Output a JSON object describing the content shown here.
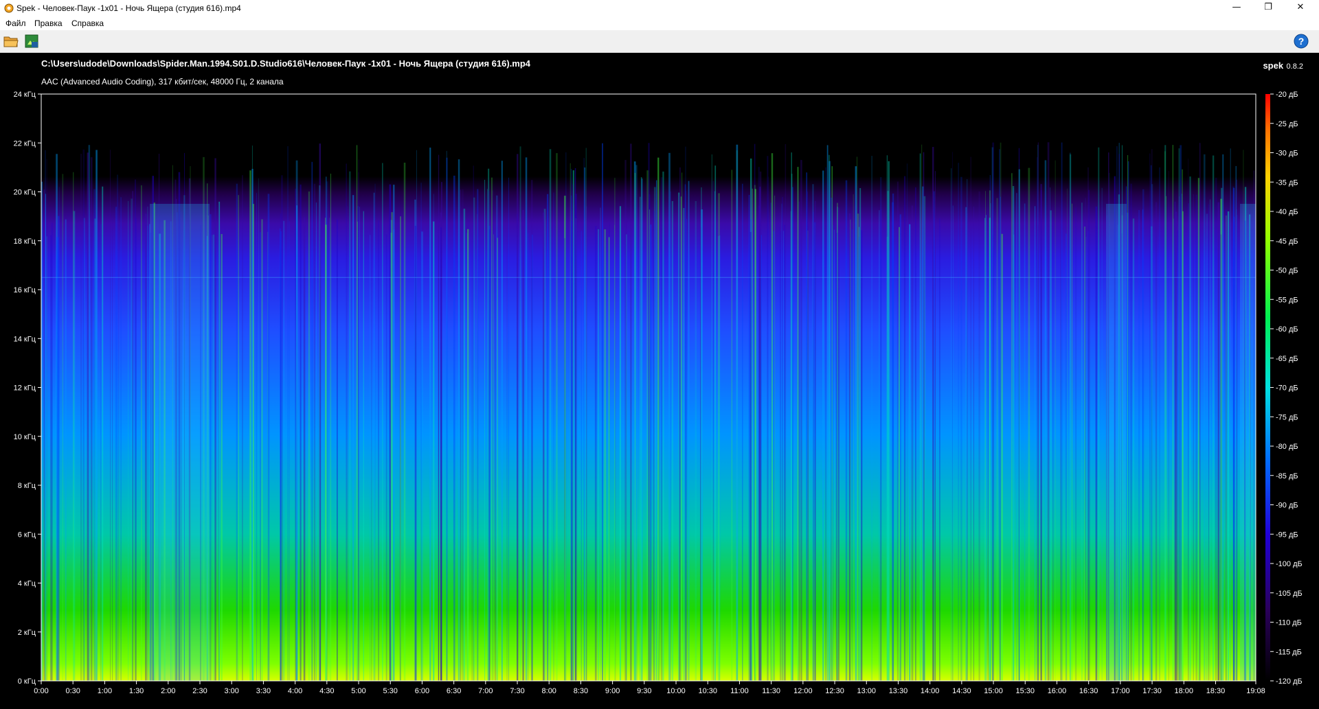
{
  "window": {
    "title": "Spek - Человек-Паук -1x01 - Ночь Ящера (студия 616).mp4",
    "minimize": "—",
    "maximize": "❐",
    "close": "✕"
  },
  "menu": {
    "file": "Файл",
    "edit": "Правка",
    "help": "Справка"
  },
  "toolbar": {
    "open_icon": "folder-open-icon",
    "save_icon": "save-image-icon",
    "help_icon": "help-icon"
  },
  "file_info": {
    "path": "C:\\Users\\udode\\Downloads\\Spider.Man.1994.S01.D.Studio616\\Человек-Паук -1x01 - Ночь Ящера (студия 616).mp4",
    "codec": "AAC (Advanced Audio Coding), 317 кбит/сек, 48000 Гц, 2 канала"
  },
  "brand": {
    "name": "spek",
    "version": "0.8.2"
  },
  "freq_labels": [
    "24 кГц",
    "22 кГц",
    "20 кГц",
    "18 кГц",
    "16 кГц",
    "14 кГц",
    "12 кГц",
    "10 кГц",
    "8 кГц",
    "6 кГц",
    "4 кГц",
    "2 кГц",
    "0 кГц"
  ],
  "time_labels": [
    "0:00",
    "0:30",
    "1:00",
    "1:30",
    "2:00",
    "2:30",
    "3:00",
    "3:30",
    "4:00",
    "4:30",
    "5:00",
    "5:30",
    "6:00",
    "6:30",
    "7:00",
    "7:30",
    "8:00",
    "8:30",
    "9:00",
    "9:30",
    "10:00",
    "10:30",
    "11:00",
    "11:30",
    "12:00",
    "12:30",
    "13:00",
    "13:30",
    "14:00",
    "14:30",
    "15:00",
    "15:30",
    "16:00",
    "16:30",
    "17:00",
    "17:30",
    "18:00",
    "18:30",
    "19:08"
  ],
  "db_labels": [
    "-20 дБ",
    "-25 дБ",
    "-30 дБ",
    "-35 дБ",
    "-40 дБ",
    "-45 дБ",
    "-50 дБ",
    "-55 дБ",
    "-60 дБ",
    "-65 дБ",
    "-70 дБ",
    "-75 дБ",
    "-80 дБ",
    "-85 дБ",
    "-90 дБ",
    "-95 дБ",
    "-100 дБ",
    "-105 дБ",
    "-110 дБ",
    "-115 дБ",
    "-120 дБ"
  ],
  "colors": {
    "background": "#000000",
    "palette": [
      "#ff0000",
      "#ff6a00",
      "#ffd000",
      "#b8ff00",
      "#2cff00",
      "#00ff8a",
      "#00e5ff",
      "#0090ff",
      "#0028ff",
      "#3000c8",
      "#200060",
      "#000000"
    ]
  }
}
